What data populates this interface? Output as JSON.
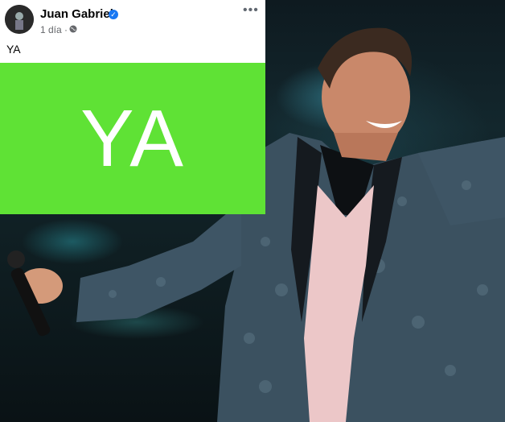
{
  "post": {
    "author": "Juan Gabriel",
    "verified_icon": "verified-badge-icon",
    "time": "1 día ·",
    "privacy_icon": "globe-icon",
    "more_label": "•••",
    "text": "YA"
  },
  "image_text": "YA",
  "colors": {
    "panel_green": "#5fe235",
    "verified_blue": "#1877f2"
  }
}
